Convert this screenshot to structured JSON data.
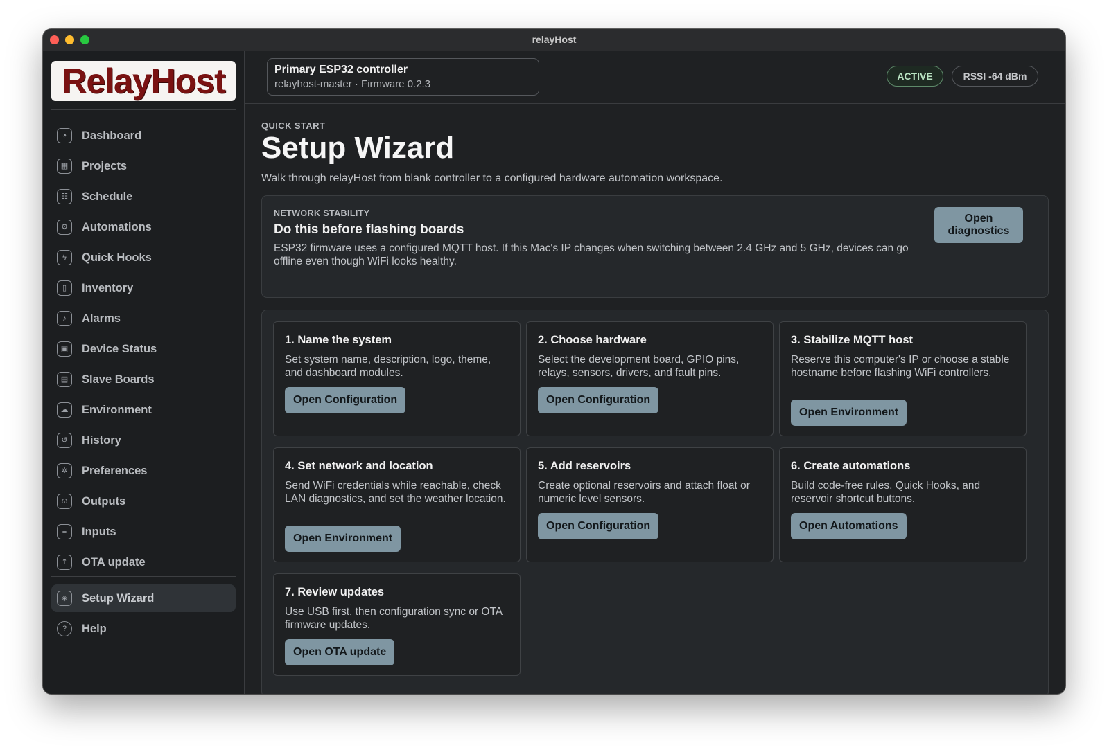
{
  "window": {
    "title": "relayHost"
  },
  "sidebar": {
    "logo_text": "RelayHost",
    "items": [
      {
        "label": "Dashboard",
        "icon": "dashboard-icon",
        "glyph": "◔"
      },
      {
        "label": "Projects",
        "icon": "projects-icon",
        "glyph": "▦"
      },
      {
        "label": "Schedule",
        "icon": "schedule-icon",
        "glyph": "☷"
      },
      {
        "label": "Automations",
        "icon": "automations-icon",
        "glyph": "⚙"
      },
      {
        "label": "Quick Hooks",
        "icon": "lightning-icon",
        "glyph": "ϟ"
      },
      {
        "label": "Inventory",
        "icon": "inventory-icon",
        "glyph": "▯"
      },
      {
        "label": "Alarms",
        "icon": "bell-icon",
        "glyph": "♪"
      },
      {
        "label": "Device Status",
        "icon": "chip-icon",
        "glyph": "▣"
      },
      {
        "label": "Slave Boards",
        "icon": "board-icon",
        "glyph": "▤"
      },
      {
        "label": "Environment",
        "icon": "cloud-icon",
        "glyph": "☁"
      },
      {
        "label": "History",
        "icon": "history-icon",
        "glyph": "↺"
      },
      {
        "label": "Preferences",
        "icon": "gear-icon",
        "glyph": "✲"
      },
      {
        "label": "Outputs",
        "icon": "outputs-icon",
        "glyph": "ω"
      },
      {
        "label": "Inputs",
        "icon": "inputs-icon",
        "glyph": "≡"
      },
      {
        "label": "OTA update",
        "icon": "upload-icon",
        "glyph": "↥"
      }
    ],
    "bottom_items": [
      {
        "label": "Setup Wizard",
        "icon": "layers-icon",
        "glyph": "◈",
        "active": true
      },
      {
        "label": "Help",
        "icon": "help-icon",
        "glyph": "?"
      }
    ]
  },
  "header": {
    "controller_name": "Primary ESP32 controller",
    "controller_sub": "relayhost-master · Firmware 0.2.3",
    "status_badge": "ACTIVE",
    "rssi_badge": "RSSI -64 dBm"
  },
  "page": {
    "eyebrow": "QUICK START",
    "title": "Setup Wizard",
    "description": "Walk through relayHost from blank controller to a configured hardware automation workspace."
  },
  "notice": {
    "eyebrow": "NETWORK STABILITY",
    "title": "Do this before flashing boards",
    "body": "ESP32 firmware uses a configured MQTT host. If this Mac's IP changes when switching between 2.4 GHz and 5 GHz, devices can go offline even though WiFi looks healthy.",
    "button": "Open diagnostics"
  },
  "steps": [
    {
      "title": "1. Name the system",
      "body": "Set system name, description, logo, theme, and dashboard modules.",
      "button": "Open Configuration"
    },
    {
      "title": "2. Choose hardware",
      "body": "Select the development board, GPIO pins, relays, sensors, drivers, and fault pins.",
      "button": "Open Configuration"
    },
    {
      "title": "3. Stabilize MQTT host",
      "body": "Reserve this computer's IP or choose a stable hostname before flashing WiFi controllers.",
      "button": "Open Environment"
    },
    {
      "title": "4. Set network and location",
      "body": "Send WiFi credentials while reachable, check LAN diagnostics, and set the weather location.",
      "button": "Open Environment"
    },
    {
      "title": "5. Add reservoirs",
      "body": "Create optional reservoirs and attach float or numeric level sensors.",
      "button": "Open Configuration"
    },
    {
      "title": "6. Create automations",
      "body": "Build code-free rules, Quick Hooks, and reservoir shortcut buttons.",
      "button": "Open Automations"
    },
    {
      "title": "7. Review updates",
      "body": "Use USB first, then configuration sync or OTA firmware updates.",
      "button": "Open OTA update"
    }
  ]
}
